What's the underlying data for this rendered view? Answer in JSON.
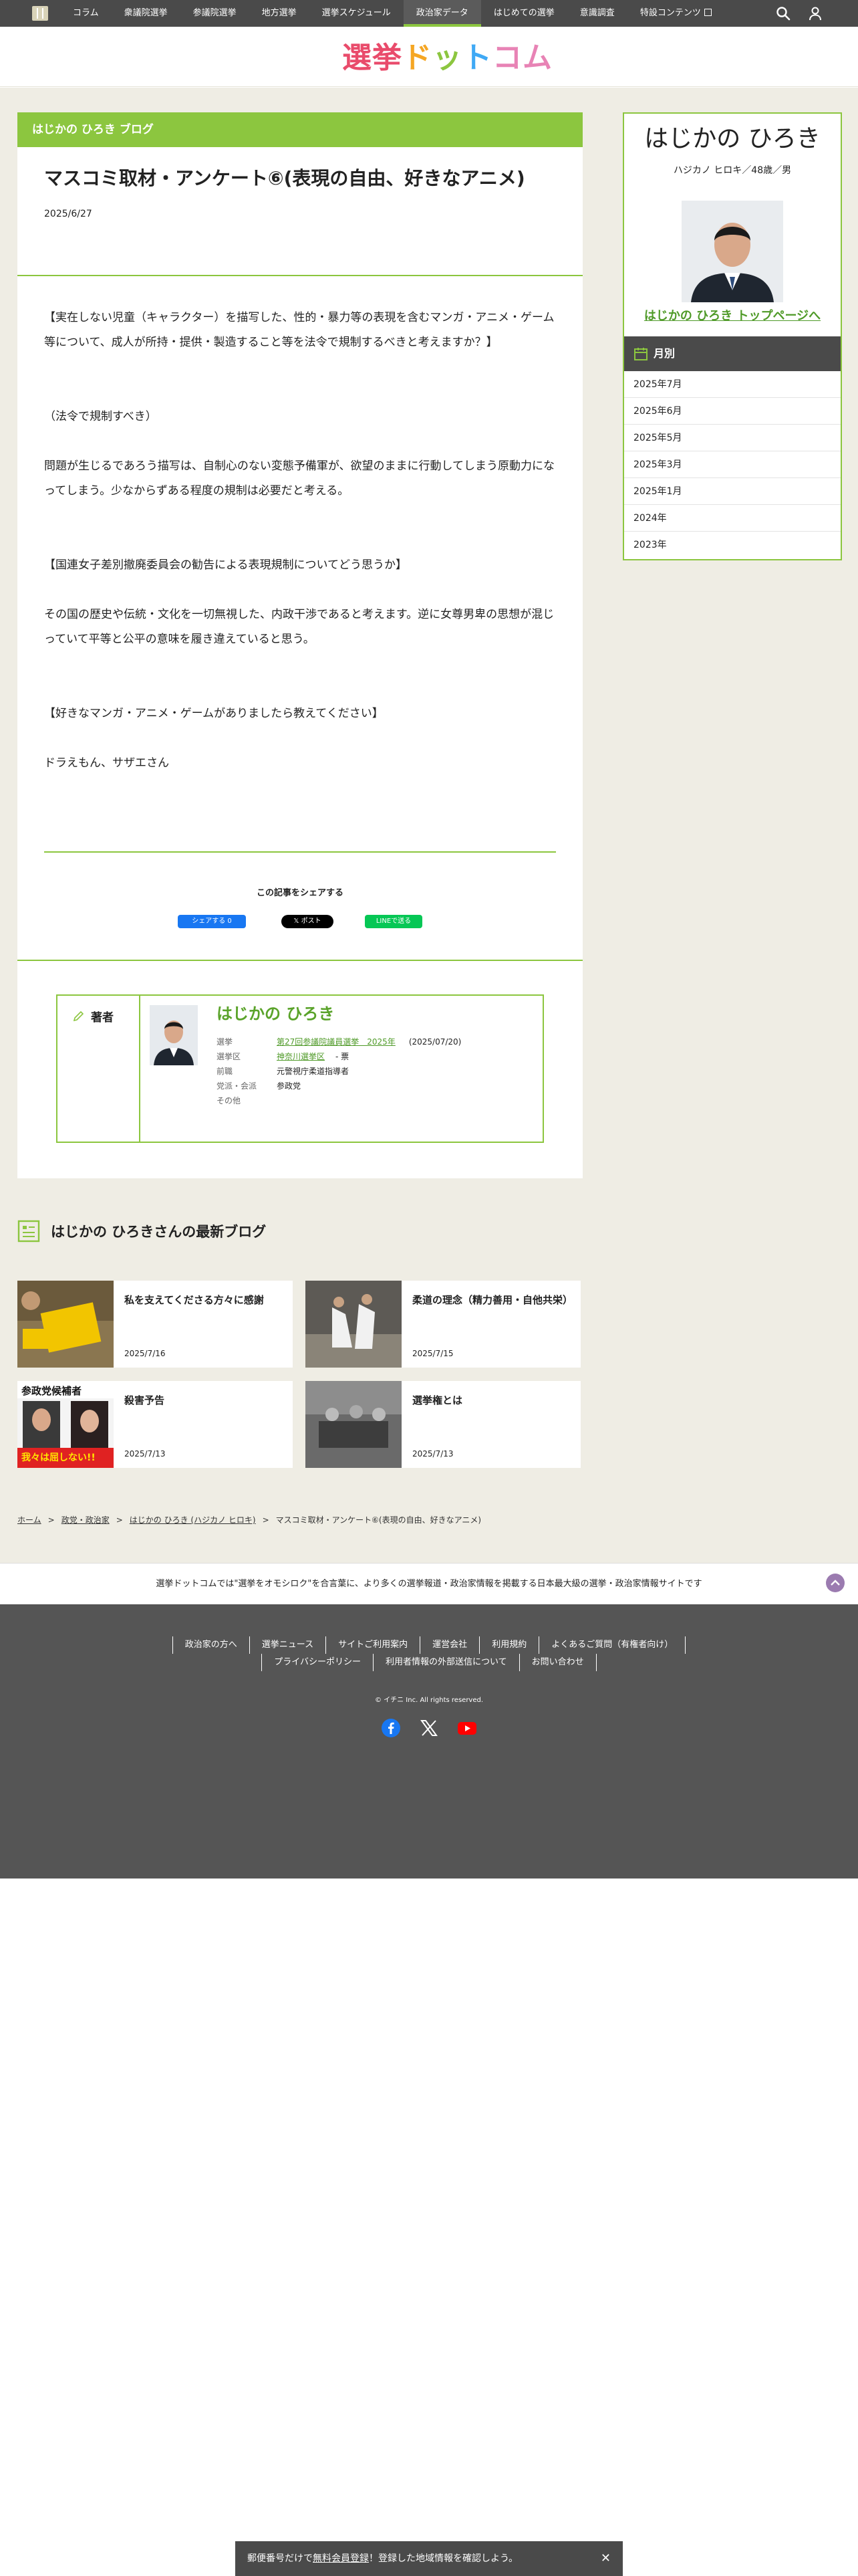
{
  "nav": {
    "items": [
      "コラム",
      "衆議院選挙",
      "参議院選挙",
      "地方選挙",
      "選挙スケジュール",
      "政治家データ",
      "はじめての選挙",
      "意識調査",
      "特設コンテンツ"
    ],
    "active_index": 5
  },
  "brand": {
    "chars": [
      "選",
      "挙",
      "ド",
      "ッ",
      "ト",
      "コ",
      "ム"
    ],
    "colors": [
      "#e94b6b",
      "#e94b6b",
      "#f5a623",
      "#8cc63f",
      "#3fa9f5",
      "#e883b5",
      "#e883b5"
    ]
  },
  "article": {
    "blog_header": "はじかの ひろき ブログ",
    "title": "マスコミ取材・アンケート⑥(表現の自由、好きなアニメ)",
    "date": "2025/6/27",
    "p1": "【実在しない児童（キャラクター）を描写した、性的・暴力等の表現を含むマンガ・アニメ・ゲーム等について、成人が所持・提供・製造すること等を法令で規制するべきと考えますか？】",
    "p2": "（法令で規制すべき）",
    "p3": "問題が生じるであろう描写は、自制心のない変態予備軍が、欲望のままに行動してしまう原動力になってしまう。少なからずある程度の規制は必要だと考える。",
    "p4": "【国連女子差別撤廃委員会の勧告による表現規制についてどう思うか】",
    "p5": "その国の歴史や伝統・文化を一切無視した、内政干渉であると考えます。逆に女尊男卑の思想が混じっていて平等と公平の意味を履き違えていると思う。",
    "p6": "【好きなマンガ・アニメ・ゲームがありましたら教えてください】",
    "p7": "ドラえもん、サザエさん"
  },
  "share": {
    "title": "この記事をシェアする",
    "fb": "シェアする 0",
    "x": "𝕏 ポスト",
    "line": "LINEで送る"
  },
  "author": {
    "label": "著者",
    "name": "はじかの ひろき",
    "election_key": "選挙",
    "election_value": "第27回参議院議員選挙　2025年",
    "election_date": "(2025/07/20)",
    "district_key": "選挙区",
    "district_value": "神奈川選挙区",
    "district_votes": "- 票",
    "former_key": "前職",
    "former_value": "元警視庁柔道指導者",
    "party_key": "党派・会派",
    "party_value": "参政党",
    "other_key": "その他"
  },
  "sidebar": {
    "name": "はじかの ひろき",
    "kana": "ハジカノ ヒロキ／48歳／男",
    "top_link": "はじかの ひろき トップページへ",
    "month_title": "月別",
    "months": [
      "2025年7月",
      "2025年6月",
      "2025年5月",
      "2025年3月",
      "2025年1月",
      "2024年",
      "2023年"
    ]
  },
  "latest": {
    "title": "はじかの ひろきさんの最新ブログ",
    "posts": [
      {
        "title": "私を支えてくださる方々に感謝",
        "date": "2025/7/16"
      },
      {
        "title": "柔道の理念（精力善用・自他共栄）",
        "date": "2025/7/15"
      },
      {
        "title": "殺害予告",
        "date": "2025/7/13",
        "thumb_top": "参政党候補者",
        "thumb_bottom": "我々は屈しない!!"
      },
      {
        "title": "選挙権とは",
        "date": "2025/7/13"
      }
    ]
  },
  "breadcrumb": {
    "home": "ホーム",
    "politicians": "政党・政治家",
    "person": "はじかの ひろき (ハジカノ ヒロキ)",
    "current": "マスコミ取材・アンケート⑥(表現の自由、好きなアニメ)"
  },
  "tagline": "選挙ドットコムでは\"選挙をオモシロク\"を合言葉に、より多くの選挙報道・政治家情報を掲載する日本最大級の選挙・政治家情報サイトです",
  "footer": {
    "row1": [
      "政治家の方へ",
      "選挙ニュース",
      "サイトご利用案内",
      "運営会社",
      "利用規約",
      "よくあるご質問（有権者向け）"
    ],
    "row2": [
      "プライバシーポリシー",
      "利用者情報の外部送信について",
      "お問い合わせ"
    ],
    "copyright": "© イチニ Inc. All rights reserved."
  },
  "bottom_banner": {
    "pre": "郵便番号だけで",
    "link": "無料会員登録",
    "post": "！登録した地域情報を確認しよう。"
  }
}
